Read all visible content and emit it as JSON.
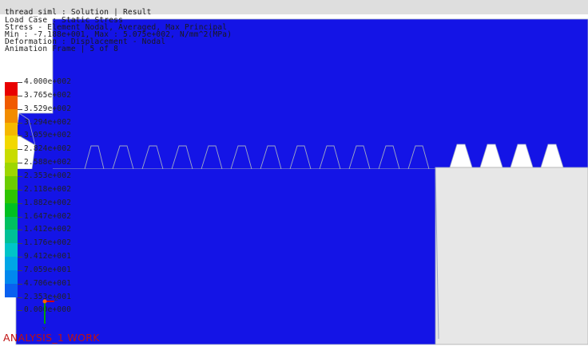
{
  "header": {
    "line1": "thread_siml : Solution | Result",
    "line2": "Load Case : Static Stress",
    "line3": "Stress - Element Nodal, Averaged, Max Principal",
    "line4": "Min : -7.188e+001, Max : 5.075e+002, N/mm^2(MPa)",
    "line5": "Deformation : Displacement - Nodal",
    "line6": "Animation Frame | 5 of 8"
  },
  "legend": {
    "labels": [
      "4.000e+002",
      "3.765e+002",
      "3.529e+002",
      "3.294e+002",
      "3.059e+002",
      "2.824e+002",
      "2.588e+002",
      "2.353e+002",
      "2.118e+002",
      "1.882e+002",
      "1.647e+002",
      "1.412e+002",
      "1.176e+002",
      "9.412e+001",
      "7.059e+001",
      "4.706e+001",
      "2.353e+001",
      "0.000e+000"
    ],
    "colors": [
      "#e80000",
      "#f05a00",
      "#f28c00",
      "#f5b800",
      "#f2d800",
      "#c8dc00",
      "#9ed600",
      "#6ccc00",
      "#2ec400",
      "#00c020",
      "#00c060",
      "#00c096",
      "#00c4c8",
      "#00a6e6",
      "#0088ee",
      "#0a60f0"
    ]
  },
  "triad": {
    "y_label": "Y",
    "z_label": "Z"
  },
  "status": {
    "text": "ANALYSIS_1 WORK"
  },
  "colors": {
    "mesh_fill": "#1414e6",
    "mesh_outline": "#9fa8c4",
    "background_light": "#e7e7e7"
  }
}
